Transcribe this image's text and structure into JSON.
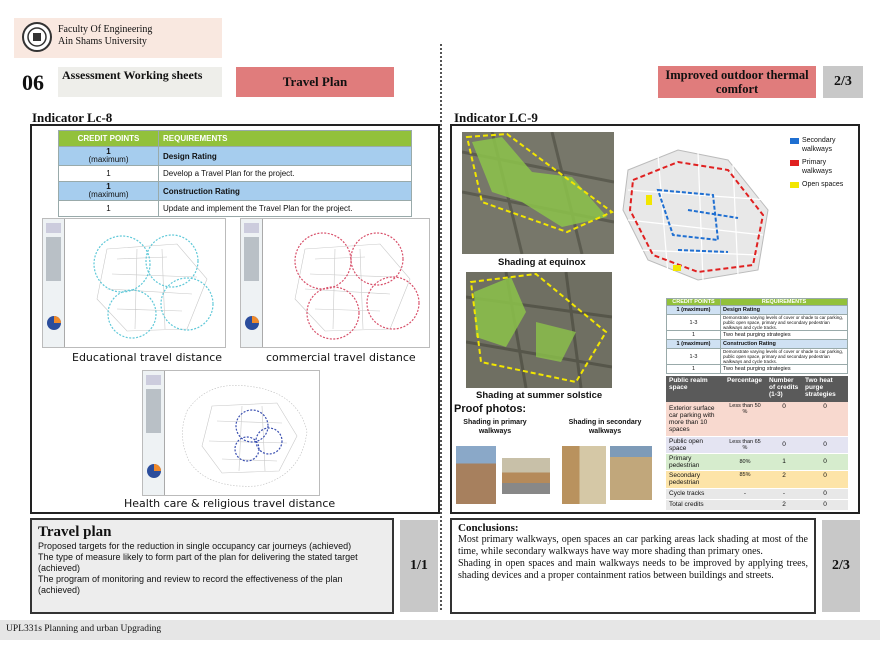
{
  "header": {
    "faculty_line1": "Faculty Of Engineering",
    "faculty_line2": "Ain Shams University",
    "section_number": "06",
    "section_title": "Assessment Working sheets",
    "left_title": "Travel Plan",
    "right_title": "Improved outdoor thermal comfort",
    "right_page": "2/3"
  },
  "left": {
    "indicator": "Indicator Lc-8",
    "credit_table": {
      "headers": [
        "CREDIT POINTS",
        "REQUIREMENTS"
      ],
      "rows": [
        {
          "credit": "1",
          "credit_note": "(maximum)",
          "requirement": "Design Rating",
          "highlight": true
        },
        {
          "credit": "1",
          "credit_note": "",
          "requirement": "Develop a Travel Plan for the project.",
          "highlight": false
        },
        {
          "credit": "1",
          "credit_note": "(maximum)",
          "requirement": "Construction Rating",
          "highlight": true
        },
        {
          "credit": "1",
          "credit_note": "",
          "requirement": "Update and implement the Travel Plan for the project.",
          "highlight": false
        }
      ]
    },
    "captions": {
      "educational": "Educational travel distance",
      "commercial": "commercial travel distance",
      "health": "Health care & religious travel distance"
    },
    "colors": {
      "educational": "#5ec8d8",
      "commercial": "#d8506a",
      "health": "#3a4fb0"
    },
    "bottom": {
      "title": "Travel plan",
      "lines": [
        "Proposed targets for the reduction in single occupancy car journeys (achieved)",
        " The type of measure likely to form part of the plan for delivering the stated target (achieved)",
        "The program of monitoring and review to record the effectiveness of the plan (achieved)"
      ],
      "page": "1/1"
    }
  },
  "right": {
    "indicator": "Indicator LC-9",
    "legend": [
      {
        "label": "Secondary walkways",
        "color": "#1f6fd1"
      },
      {
        "label": "Primary walkways",
        "color": "#e02020"
      },
      {
        "label": "Open spaces",
        "color": "#f2e600"
      }
    ],
    "captions": {
      "equinox": "Shading at equinox",
      "solstice": "Shading at summer solstice",
      "proof": "Proof photos:",
      "primary": "Shading in primary walkways",
      "secondary": "Shading in secondary walkways"
    },
    "lc9_table": {
      "headers": [
        "CREDIT POINTS",
        "REQUIREMENTS"
      ],
      "rows": [
        {
          "credit": "1 (maximum)",
          "requirement": "Design Rating",
          "highlight": true
        },
        {
          "credit": "1-3",
          "requirement": "Demonstrate varying levels of cover or shade to car parking, public open space, primary and secondary pedestrian walkways and cycle tracks.",
          "highlight": false
        },
        {
          "credit": "1",
          "requirement": "Two heat purging strategies",
          "highlight": false
        },
        {
          "credit": "1 (maximum)",
          "requirement": "Construction Rating",
          "highlight": true
        },
        {
          "credit": "1-3",
          "requirement": "Demonstrate varying levels of cover or shade to car parking, public open space, primary and secondary pedestrian walkways and cycle tracks.",
          "highlight": false
        },
        {
          "credit": "1",
          "requirement": "Two heat purging strategies",
          "highlight": false
        }
      ]
    },
    "realm_table": {
      "headers": [
        "Public realm space",
        "Percentage",
        "Number of credits (1-3)",
        "Two heat purge strategies"
      ],
      "rows": [
        {
          "space": "Exterior surface car parking with more than 10 spaces",
          "percentage": "Less than 50 %",
          "credits": "0",
          "strategies": "0",
          "bg": "#f8d9cf"
        },
        {
          "space": "Public open space",
          "percentage": "Less than 65 %",
          "credits": "0",
          "strategies": "0",
          "bg": "#e4e4f2"
        },
        {
          "space": "Primary pedestrian",
          "percentage": "80%",
          "credits": "1",
          "strategies": "0",
          "bg": "#d6eccd"
        },
        {
          "space": "Secondary pedestrian",
          "percentage": "85%",
          "credits": "2",
          "strategies": "0",
          "bg": "#fde4a8"
        },
        {
          "space": "Cycle tracks",
          "percentage": "-",
          "credits": "-",
          "strategies": "0",
          "bg": "#e8e8e8"
        },
        {
          "space": "Total credits",
          "percentage": "",
          "credits": "2",
          "strategies": "0",
          "bg": "#e8e8e8"
        }
      ]
    },
    "conclusions": {
      "title": "Conclusions:",
      "text1": "Most primary walkways, open spaces an car parking areas lack shading at most of the time, while secondary walkways have way more shading than primary ones.",
      "text2": "Shading in open spaces and main walkways needs to be improved by applying trees, shading devices and a proper containment ratios between buildings and streets."
    },
    "bottom_page": "2/3"
  },
  "footer": "UPL331s Planning and urban Upgrading"
}
